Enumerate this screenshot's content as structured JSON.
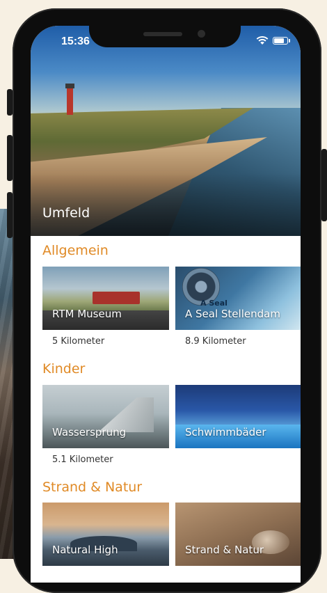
{
  "status_bar": {
    "time": "15:36"
  },
  "hero": {
    "title": "Umfeld"
  },
  "sections": [
    {
      "title": "Allgemein",
      "cards": [
        {
          "label": "RTM Museum",
          "distance": "5 Kilometer"
        },
        {
          "label": "A Seal Stellendam",
          "distance": "8.9 Kilometer",
          "logo_text": "A Seal"
        }
      ]
    },
    {
      "title": "Kinder",
      "cards": [
        {
          "label": "Wassersprung",
          "distance": "5.1 Kilometer"
        },
        {
          "label": "Schwimmbäder",
          "distance": ""
        }
      ]
    },
    {
      "title": "Strand & Natur",
      "cards": [
        {
          "label": "Natural High",
          "distance": ""
        },
        {
          "label": "Strand & Natur",
          "distance": ""
        }
      ]
    }
  ],
  "colors": {
    "accent": "#e08a26",
    "background": "#f7f0e3"
  }
}
